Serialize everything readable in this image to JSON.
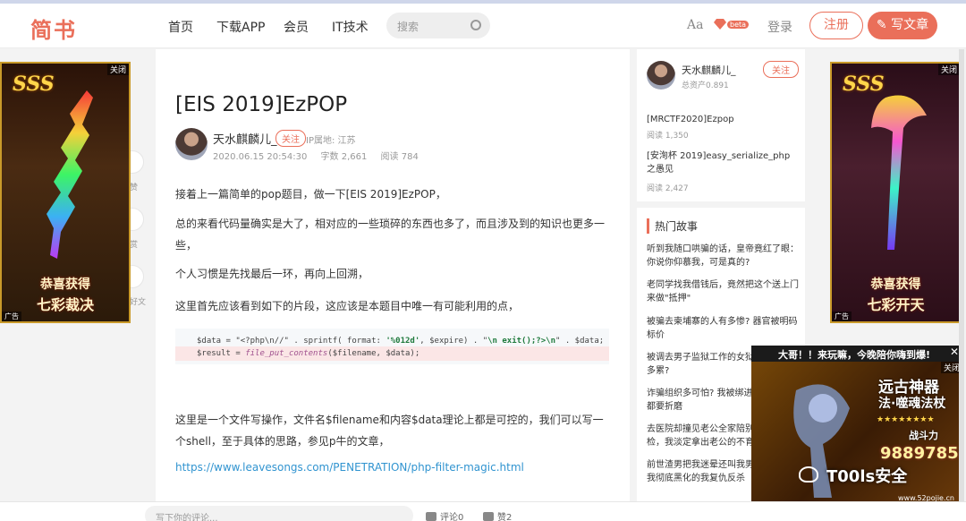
{
  "header": {
    "logo": "简书",
    "nav": [
      "首页",
      "下载APP",
      "会员",
      "IT技术"
    ],
    "search_placeholder": "搜索",
    "font_toggle": "Aa",
    "beta": "beta",
    "login": "登录",
    "register": "注册",
    "write": "写文章"
  },
  "article": {
    "title": "[EIS 2019]EzPOP",
    "author": "天水麒麟儿_",
    "follow": "关注",
    "ip": "IP属地: 江苏",
    "date": "2020.06.15 20:54:30",
    "words": "字数 2,661",
    "reads": "阅读 784",
    "paragraphs": [
      "接着上一篇简单的pop题目，做一下[EIS 2019]EzPOP，",
      "总的来看代码量确实是大了，相对应的一些琐碎的东西也多了，而且涉及到的知识也更多一些，",
      "个人习惯是先找最后一环，再向上回溯，",
      "这里首先应该看到如下的片段，这应该是本题目中唯一有可能利用的点，"
    ],
    "code_line1_a": "$data = \"<?php\\n//\" . sprintf( format: ",
    "code_fmt": "'%012d'",
    "code_line1_b": ", $expire) . \"",
    "code_exit": "\\n exit();?>\\n",
    "code_line1_c": "\" . $data;",
    "code_line2_a": "$result = ",
    "code_fn": "file_put_contents",
    "code_line2_b": "($filename, $data);",
    "paragraph5": "这里是一个文件写操作，文件名$filename和内容$data理论上都是可控的，我们可以写一个shell，至于具体的思路，参见p牛的文章，",
    "link": "https://www.leavesongs.com/PENETRATION/php-filter-magic.html"
  },
  "bottom_bar": {
    "comment_placeholder": "写下你的评论...",
    "comments": "评论0",
    "likes": "赞2"
  },
  "sidebar": {
    "author": "天水麒麟儿_",
    "assets": "总资产0.891",
    "follow": "关注",
    "posts": [
      {
        "title": "[MRCTF2020]Ezpop",
        "reads": "阅读 1,350"
      },
      {
        "title": "[安洵杯 2019]easy_serialize_php之愚见",
        "reads": "阅读 2,427"
      }
    ],
    "hot_title": "热门故事",
    "hot": [
      "听到我随口哄骗的话，皇帝竟红了眼：你说你仰慕我，可是真的?",
      "老同学找我借钱后，竟然把这个送上门来做\"抵押\"",
      "被骗去柬埔寨的人有多惨? 器官被明码标价",
      "被调去男子监狱工作的女狱警，到底有多累?",
      "诈骗组织多可怕? 我被绑进去，连子女都要折磨",
      "去医院却撞见老公全家陪别的女人产检，我淡定拿出老公的不育报告",
      "前世渣男把我迷晕还叫我男友，这一世我彻底黑化的我复仇反杀"
    ]
  },
  "float": {
    "labels": [
      "赞",
      "赏",
      "好文"
    ]
  },
  "ads": {
    "close": "关闭",
    "tag": "广告",
    "sss": "SSS",
    "left_slogan1": "恭喜获得",
    "left_slogan2": "七彩裁决",
    "right_slogan1": "恭喜获得",
    "right_slogan2": "七彩开天",
    "bottom_head": "大哥！！来玩嘛，今晚陪你嗨到爆!",
    "bottom_title1": "远古神器",
    "bottom_title2": "法·噬魂法杖",
    "bottom_power_label": "战斗力",
    "bottom_power": "9889785",
    "watermark": "T00ls安全",
    "watermark_sub": "www.52pojie.cn"
  }
}
